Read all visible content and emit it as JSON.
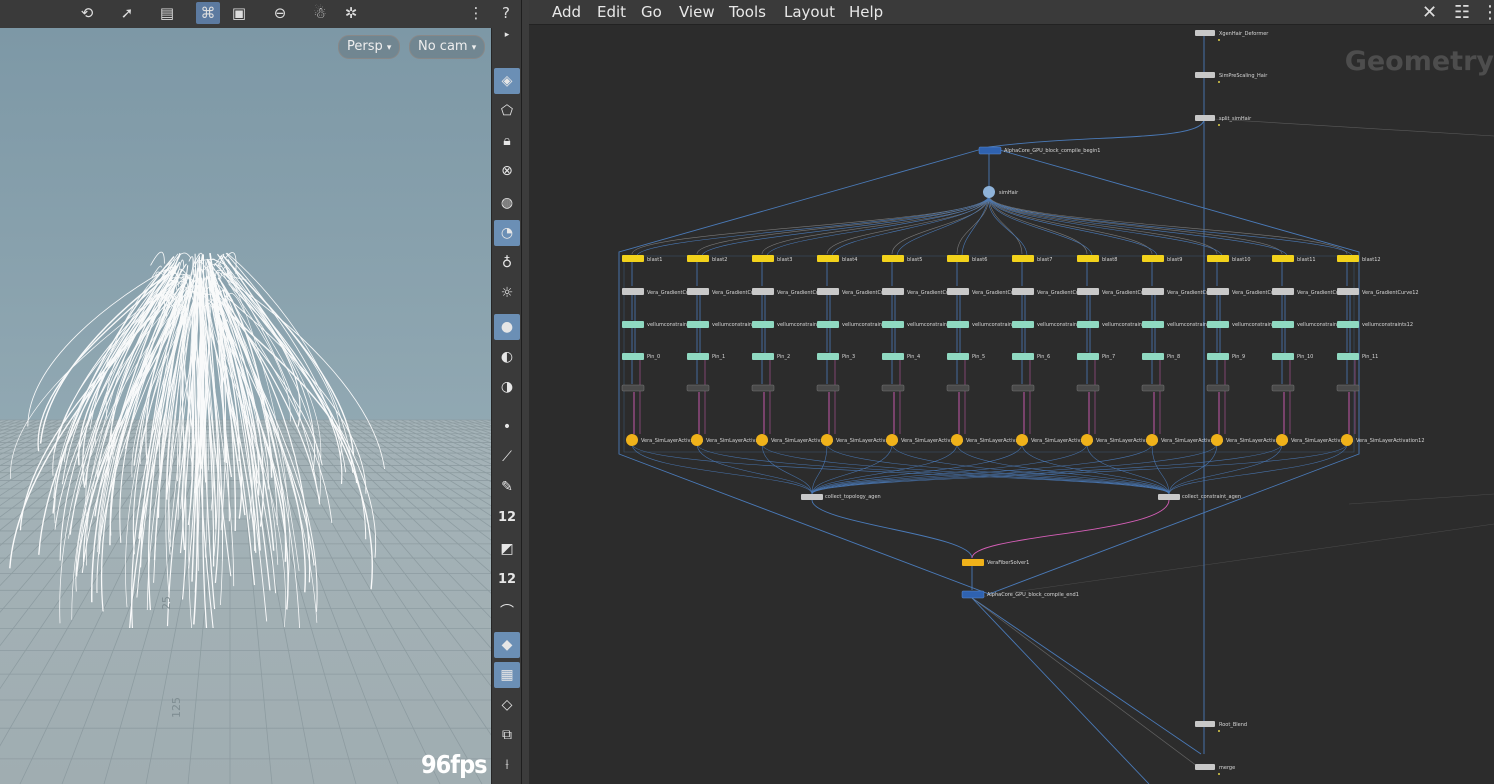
{
  "viewport": {
    "camera_menu": "Persp",
    "camera_select": "No cam",
    "fps": "96fps",
    "grid_label_1": "25",
    "grid_label_2": "125",
    "toolbar_icons": [
      "orbit-tool-icon",
      "select-tool-icon",
      "transform-tool-icon",
      "camera-tool-icon",
      "snapshot-icon",
      "stop-icon",
      "render-icon",
      "settings-icon",
      "display-options-icon",
      "help-icon"
    ],
    "shelf": {
      "snap_value_1": "12",
      "snap_value_2": "12"
    }
  },
  "menubar": {
    "items": [
      "Add",
      "Edit",
      "Go",
      "View",
      "Tools",
      "Layout",
      "Help"
    ]
  },
  "network": {
    "context_label": "Geometry",
    "top_nodes": [
      "XgenHair_Deformer",
      "SimPreScaling_Hair",
      "split_simHair"
    ],
    "block_begin": "AlphaCore_GPU_block_compile_begin1",
    "sim_hair": "simHair",
    "columns": [
      {
        "blast": "blast1",
        "curve": "Vera_GradientCurve",
        "vellum": "vellumconstraints",
        "pin": "Pin_0",
        "activation": "Vera_SimLayerActivation"
      },
      {
        "blast": "blast2",
        "curve": "Vera_GradientCurve",
        "vellum": "vellumconstraints",
        "pin": "Pin_1",
        "activation": "Vera_SimLayerActivation"
      },
      {
        "blast": "blast3",
        "curve": "Vera_GradientCurve",
        "vellum": "vellumconstraints",
        "pin": "Pin_2",
        "activation": "Vera_SimLayerActivation"
      },
      {
        "blast": "blast4",
        "curve": "Vera_GradientCurve",
        "vellum": "vellumconstraints",
        "pin": "Pin_3",
        "activation": "Vera_SimLayerActivation"
      },
      {
        "blast": "blast5",
        "curve": "Vera_GradientCurve",
        "vellum": "vellumconstraints",
        "pin": "Pin_4",
        "activation": "Vera_SimLayerActivation"
      },
      {
        "blast": "blast6",
        "curve": "Vera_GradientCurve",
        "vellum": "vellumconstraints",
        "pin": "Pin_5",
        "activation": "Vera_SimLayerActivation"
      },
      {
        "blast": "blast7",
        "curve": "Vera_GradientCurve",
        "vellum": "vellumconstraints",
        "pin": "Pin_6",
        "activation": "Vera_SimLayerActivation"
      },
      {
        "blast": "blast8",
        "curve": "Vera_GradientCurve",
        "vellum": "vellumconstraints",
        "pin": "Pin_7",
        "activation": "Vera_SimLayerActivation"
      },
      {
        "blast": "blast9",
        "curve": "Vera_GradientCurve",
        "vellum": "vellumconstraints",
        "pin": "Pin_8",
        "activation": "Vera_SimLayerActivation"
      },
      {
        "blast": "blast10",
        "curve": "Vera_GradientCurve",
        "vellum": "vellumconstraints",
        "pin": "Pin_9",
        "activation": "Vera_SimLayerActivation"
      },
      {
        "blast": "blast11",
        "curve": "Vera_GradientCurve",
        "vellum": "vellumconstraints",
        "pin": "Pin_10",
        "activation": "Vera_SimLayerActivation"
      },
      {
        "blast": "blast12",
        "curve": "Vera_GradientCurve12",
        "vellum": "vellumconstraints12",
        "pin": "Pin_11",
        "activation": "Vera_SimLayerActivation12"
      }
    ],
    "collect_topology": "collect_topology_agen",
    "collect_constraint": "collect_constraint_agen",
    "solver": "VeraFiberSolver1",
    "block_end": "AlphaCore_GPU_block_compile_end1",
    "root_blend": "Root_Blend",
    "merge": "merge"
  }
}
